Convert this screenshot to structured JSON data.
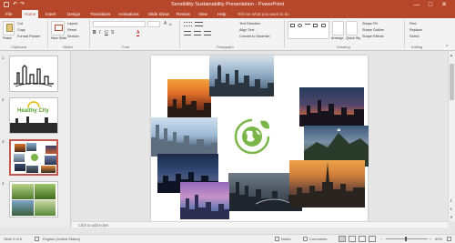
{
  "titlebar": {
    "title": "Sensibility Sustainability Presentation - PowerPoint",
    "window_controls": [
      "—",
      "□",
      "✕"
    ]
  },
  "ribbon_tabs": [
    "File",
    "Home",
    "Insert",
    "Design",
    "Transitions",
    "Animations",
    "Slide Show",
    "Review",
    "View",
    "Help",
    "Tell me what you want to do"
  ],
  "ribbon": {
    "groups": [
      "Clipboard",
      "Slides",
      "Font",
      "Paragraph",
      "Drawing",
      "Editing"
    ],
    "clipboard": {
      "paste": "Paste",
      "cut": "Cut",
      "copy": "Copy",
      "format_painter": "Format Painter"
    },
    "slides": {
      "new_slide": "New Slide",
      "layout": "Layout",
      "reset": "Reset",
      "section": "Section"
    },
    "paragraph": {
      "text_direction": "Text Direction",
      "align_text": "Align Text",
      "smartart": "Convert to SmartArt"
    },
    "drawing": {
      "arrange": "Arrange",
      "quick_styles": "Quick Styles",
      "shape_fill": "Shape Fill",
      "shape_outline": "Shape Outline",
      "shape_effects": "Shape Effects"
    },
    "editing": {
      "find": "Find",
      "replace": "Replace",
      "select": "Select"
    }
  },
  "thumbnails": [
    {
      "num": "1",
      "label": ""
    },
    {
      "num": "2",
      "label": "Healthy City"
    },
    {
      "num": "3",
      "label": ""
    },
    {
      "num": "4",
      "label": ""
    }
  ],
  "notes_placeholder": "Click to add notes",
  "statusbar": {
    "slide": "Slide 3 of 5",
    "language": "English (United States)",
    "notes": "Notes",
    "comments": "Comments",
    "zoom": "59%"
  },
  "colors": {
    "accent": "#b7472a",
    "selected_thumb": "#c4574c",
    "logo_green": "#7ab648"
  }
}
